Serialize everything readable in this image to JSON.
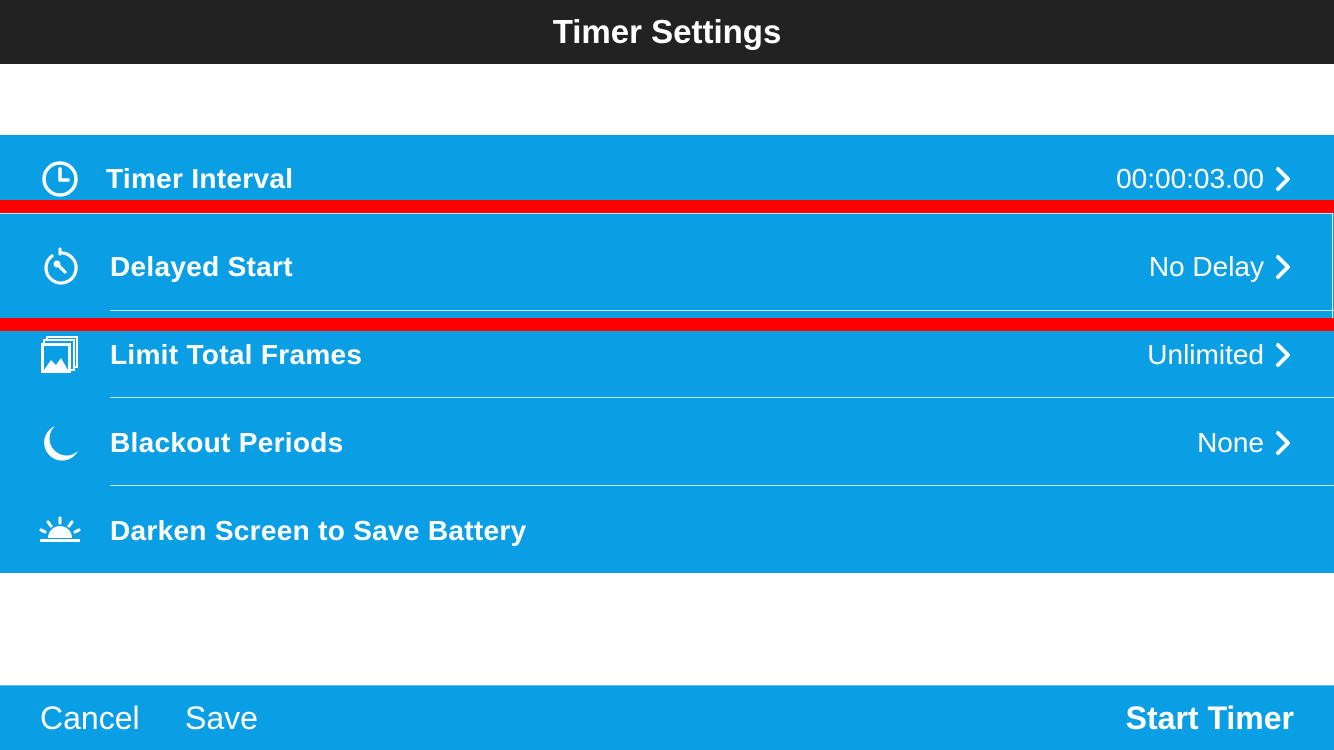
{
  "header": {
    "title": "Timer Settings"
  },
  "settings": [
    {
      "icon": "clock-icon",
      "label": "Timer Interval",
      "value": "00:00:03.00",
      "has_chevron": true
    },
    {
      "icon": "stopwatch-icon",
      "label": "Delayed Start",
      "value": "No Delay",
      "has_chevron": true,
      "highlighted": true
    },
    {
      "icon": "frames-icon",
      "label": "Limit Total Frames",
      "value": "Unlimited",
      "has_chevron": true
    },
    {
      "icon": "moon-icon",
      "label": "Blackout Periods",
      "value": "None",
      "has_chevron": true
    },
    {
      "icon": "sunset-icon",
      "label": "Darken Screen to Save Battery",
      "value": "",
      "has_chevron": false
    }
  ],
  "toolbar": {
    "cancel_label": "Cancel",
    "save_label": "Save",
    "start_label": "Start Timer"
  },
  "colors": {
    "accent_blue": "#0a9fe4",
    "title_bar": "#222222",
    "highlight_red": "#ff0000",
    "text": "#ffffff"
  }
}
